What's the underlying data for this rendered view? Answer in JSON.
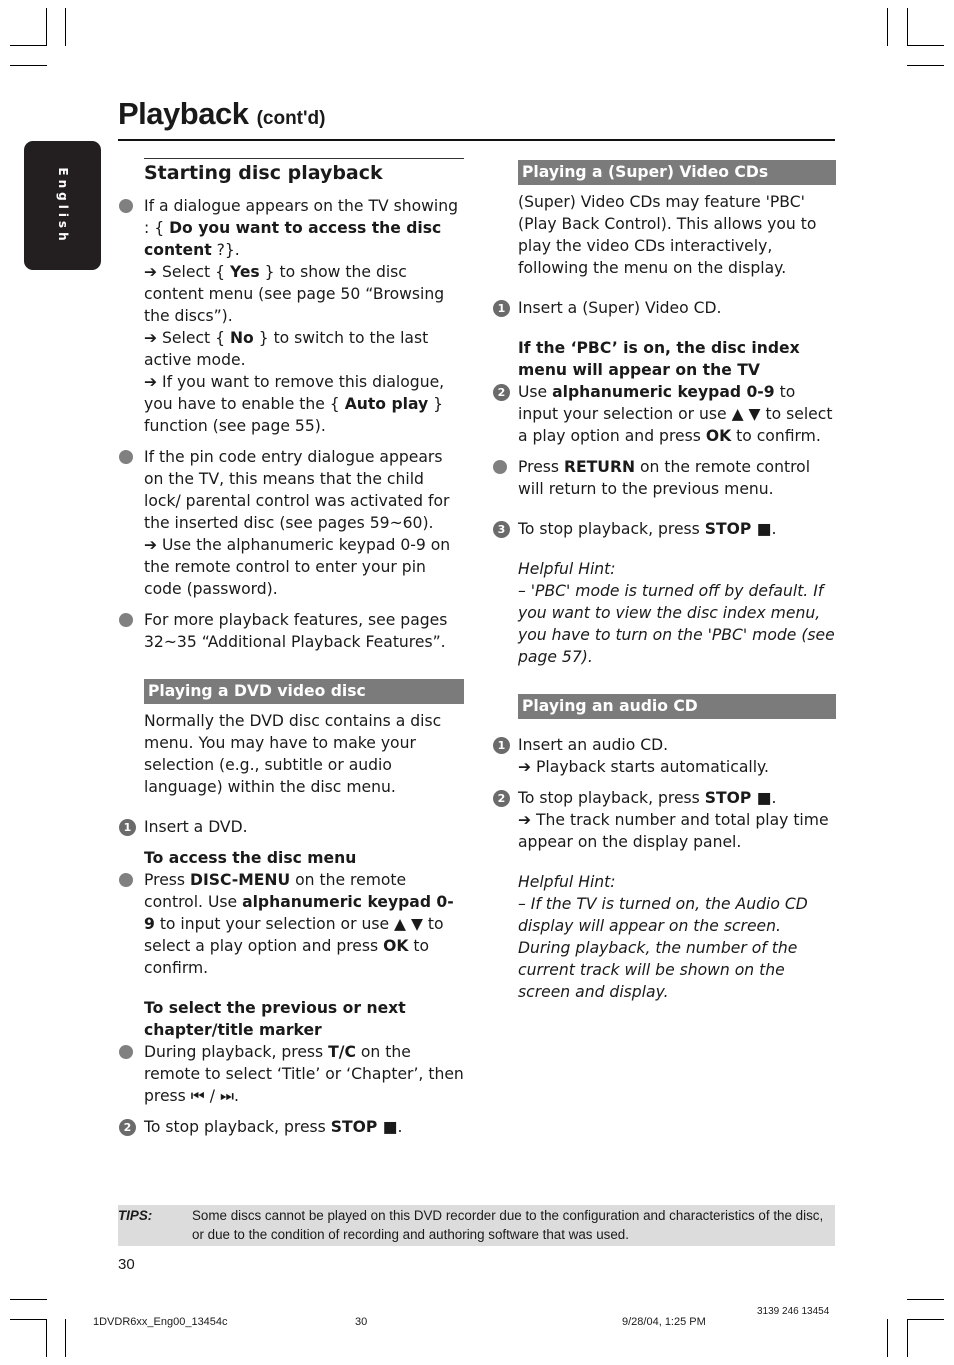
{
  "header": {
    "title": "Playback",
    "subtitle": "(cont'd)"
  },
  "language_tab": "English",
  "left": {
    "section_title": "Starting disc playback",
    "intro_items": [
      {
        "lines": [
          [
            "If a dialogue appears on the TV showing :",
            " { ",
            "Do you want to access the disc content",
            " ?}."
          ],
          [
            "➔ Select { ",
            "Yes",
            " } to show the disc content menu (see page 50 “Browsing the discs”)."
          ],
          [
            "➔ Select { ",
            "No",
            " } to switch to the last active mode."
          ],
          [
            "➔ If you want to remove this dialogue, you have to enable the { ",
            "Auto play",
            " } function (see page 55)."
          ]
        ]
      },
      {
        "text": "If the pin code entry dialogue appears on the TV, this means that the child lock/ parental control was activated for the inserted disc (see pages 59~60).",
        "arrow": "➔ Use the alphanumeric keypad 0-9 on the remote control to enter your pin code (password)."
      },
      {
        "text": "For more playback features, see pages 32~35 “Additional Playback Features”."
      }
    ],
    "dvd": {
      "heading": "Playing a DVD video disc",
      "intro": "Normally the DVD disc contains a disc menu. You may have to make your selection (e.g., subtitle or audio language) within the disc menu.",
      "step1": {
        "num": "1",
        "text": "Insert a DVD."
      },
      "menu_head": "To access the disc menu",
      "menu_item": {
        "p1": "Press ",
        "b1": "DISC-MENU",
        "p2": " on the remote control. Use ",
        "b2": "alphanumeric keypad 0-9",
        "p3": " to input your selection or use ▲ ▼ to select a play option and press ",
        "b3": "OK",
        "p4": " to confirm."
      },
      "marker_head": "To select the previous or next chapter/title marker",
      "marker_item": {
        "p1": "During playback, press ",
        "b1": "T/C",
        "p2": " on the remote to select ‘Title’ or ‘Chapter’, then press ⏮ / ⏭."
      },
      "step2": {
        "num": "2",
        "p1": "To stop playback, press ",
        "b1": "STOP ■",
        "p2": "."
      }
    }
  },
  "right": {
    "vcd": {
      "heading": "Playing a (Super) Video CDs",
      "intro": "(Super) Video CDs may feature 'PBC' (Play Back Control). This allows you to play the video CDs interactively, following the menu on the display.",
      "step1": {
        "num": "1",
        "text": "Insert a (Super) Video CD."
      },
      "pbc_head": "If the ‘PBC’ is on, the disc index menu will appear on the TV",
      "step2": {
        "num": "2",
        "p1": "Use ",
        "b1": "alphanumeric keypad 0-9",
        "p2": " to input your selection or use ▲ ▼ to select a play option and press ",
        "b2": "OK",
        "p3": " to confirm."
      },
      "return_item": {
        "p1": "Press ",
        "b1": "RETURN",
        "p2": " on the remote control will return to the previous menu."
      },
      "step3": {
        "num": "3",
        "p1": "To stop playback, press ",
        "b1": "STOP ■",
        "p2": "."
      },
      "hint_label": "Helpful Hint:",
      "hint_text": "–  'PBC' mode is turned off by default.  If you want to view the disc index menu, you have to turn on the 'PBC' mode (see page 57)."
    },
    "audio": {
      "heading": "Playing an audio CD",
      "step1": {
        "num": "1",
        "text": "Insert an audio CD.",
        "arrow": "➔ Playback starts automatically."
      },
      "step2": {
        "num": "2",
        "p1": "To stop playback, press ",
        "b1": "STOP ■",
        "p2": ".",
        "arrow": "➔ The track number and total play time appear on the display panel."
      },
      "hint_label": "Helpful Hint:",
      "hint_text": "–  If the TV is turned on, the Audio CD display will appear on the screen. During playback, the number of the current track will be shown on the screen and display."
    }
  },
  "tips": {
    "label": "TIPS:",
    "text": "Some discs cannot be played on this DVD recorder due to the configuration and characteristics of the disc, or due to the condition of recording and authoring software that was used."
  },
  "page_number": "30",
  "footer": {
    "file": "1DVDR6xx_Eng00_13454c",
    "page": "30",
    "datetime": "9/28/04, 1:25 PM",
    "code": "3139 246 13454"
  }
}
